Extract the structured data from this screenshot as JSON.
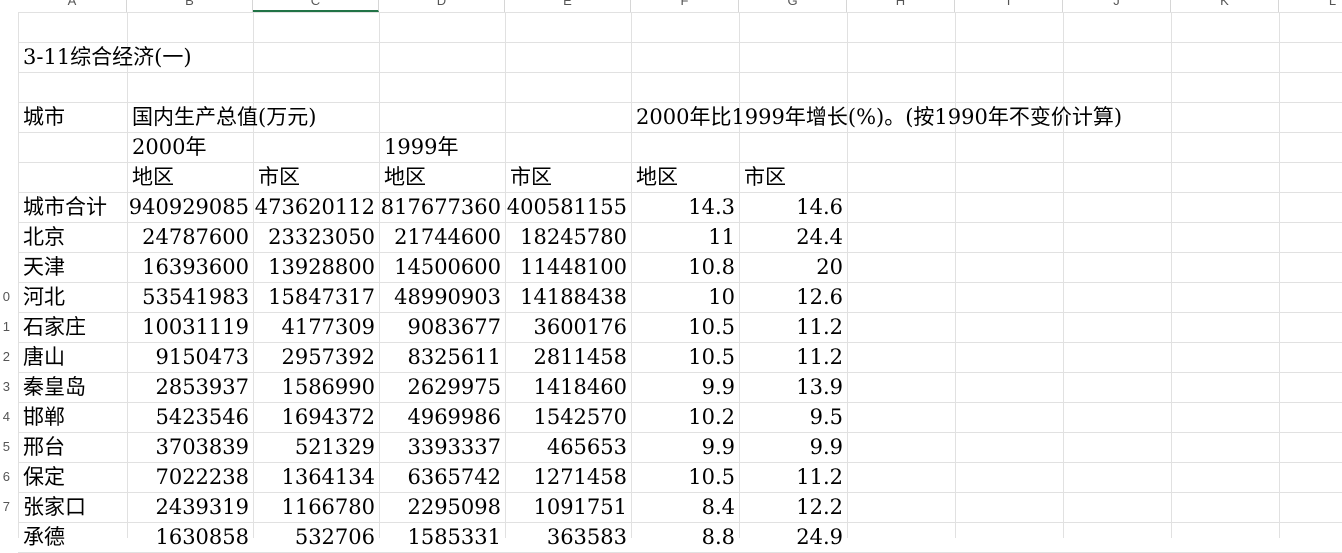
{
  "columns": [
    "A",
    "B",
    "C",
    "D",
    "E",
    "F",
    "G",
    "H",
    "I",
    "J",
    "K",
    "L"
  ],
  "row_numbers": [
    "",
    "",
    "",
    "",
    "",
    "",
    "",
    "",
    "",
    "0",
    "1",
    "2",
    "3",
    "4",
    "5",
    "6",
    "7",
    ""
  ],
  "title": "3-11综合经济(一)",
  "header": {
    "col_a": "城市",
    "gdp_label": "国内生产总值(万元)",
    "growth_label": "2000年比1999年增长(%)。(按1990年不变价计算)",
    "year_2000": "2000年",
    "year_1999": "1999年",
    "sub_diqu_1": "地区",
    "sub_shiqu_1": "市区",
    "sub_diqu_2": "地区",
    "sub_shiqu_2": "市区",
    "sub_diqu_3": "地区",
    "sub_shiqu_3": "市区"
  },
  "rows": [
    {
      "city": "城市合计",
      "b": "940929085",
      "c": "473620112",
      "d": "817677360",
      "e": "400581155",
      "f": "14.3",
      "g": "14.6"
    },
    {
      "city": "北京",
      "b": "24787600",
      "c": "23323050",
      "d": "21744600",
      "e": "18245780",
      "f": "11",
      "g": "24.4"
    },
    {
      "city": "天津",
      "b": "16393600",
      "c": "13928800",
      "d": "14500600",
      "e": "11448100",
      "f": "10.8",
      "g": "20"
    },
    {
      "city": "河北",
      "b": "53541983",
      "c": "15847317",
      "d": "48990903",
      "e": "14188438",
      "f": "10",
      "g": "12.6"
    },
    {
      "city": "石家庄",
      "b": "10031119",
      "c": "4177309",
      "d": "9083677",
      "e": "3600176",
      "f": "10.5",
      "g": "11.2"
    },
    {
      "city": "唐山",
      "b": "9150473",
      "c": "2957392",
      "d": "8325611",
      "e": "2811458",
      "f": "10.5",
      "g": "11.2"
    },
    {
      "city": "秦皇岛",
      "b": "2853937",
      "c": "1586990",
      "d": "2629975",
      "e": "1418460",
      "f": "9.9",
      "g": "13.9"
    },
    {
      "city": "邯郸",
      "b": "5423546",
      "c": "1694372",
      "d": "4969986",
      "e": "1542570",
      "f": "10.2",
      "g": "9.5"
    },
    {
      "city": "邢台",
      "b": "3703839",
      "c": "521329",
      "d": "3393337",
      "e": "465653",
      "f": "9.9",
      "g": "9.9"
    },
    {
      "city": "保定",
      "b": "7022238",
      "c": "1364134",
      "d": "6365742",
      "e": "1271458",
      "f": "10.5",
      "g": "11.2"
    },
    {
      "city": "张家口",
      "b": "2439319",
      "c": "1166780",
      "d": "2295098",
      "e": "1091751",
      "f": "8.4",
      "g": "12.2"
    },
    {
      "city": "承德",
      "b": "1630858",
      "c": "532706",
      "d": "1585331",
      "e": "363583",
      "f": "8.8",
      "g": "24.9"
    }
  ]
}
